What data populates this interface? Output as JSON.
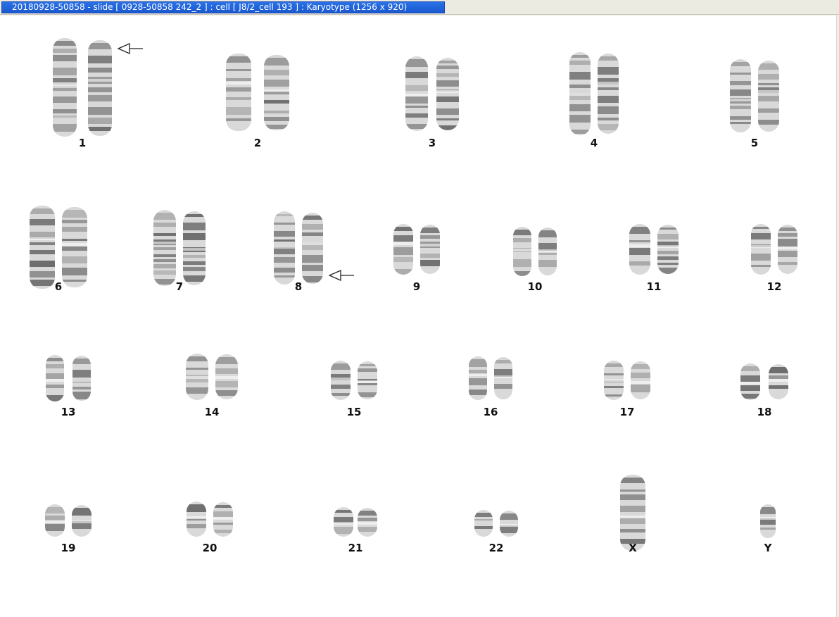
{
  "window": {
    "title": "20180928-50858 - slide [ 0928-50858 242_2 ] : cell [ J8/2_cell 193 ] : Karyotype  (1256 x 920)"
  },
  "colors": {
    "chromosome_light": "#d9d9d9",
    "chromosome_band": "#5a5a5a",
    "title_active": "#2a71e6",
    "title_text": "#ffffff"
  },
  "karyotype": {
    "chromosomes": [
      {
        "label": "1",
        "count": 2,
        "flagged": true
      },
      {
        "label": "2",
        "count": 2,
        "flagged": false
      },
      {
        "label": "3",
        "count": 2,
        "flagged": false
      },
      {
        "label": "4",
        "count": 2,
        "flagged": false
      },
      {
        "label": "5",
        "count": 2,
        "flagged": false
      },
      {
        "label": "6",
        "count": 2,
        "flagged": false
      },
      {
        "label": "7",
        "count": 2,
        "flagged": false
      },
      {
        "label": "8",
        "count": 2,
        "flagged": true
      },
      {
        "label": "9",
        "count": 2,
        "flagged": false
      },
      {
        "label": "10",
        "count": 2,
        "flagged": false
      },
      {
        "label": "11",
        "count": 2,
        "flagged": false
      },
      {
        "label": "12",
        "count": 2,
        "flagged": false
      },
      {
        "label": "13",
        "count": 2,
        "flagged": false
      },
      {
        "label": "14",
        "count": 2,
        "flagged": false
      },
      {
        "label": "15",
        "count": 2,
        "flagged": false
      },
      {
        "label": "16",
        "count": 2,
        "flagged": false
      },
      {
        "label": "17",
        "count": 2,
        "flagged": false
      },
      {
        "label": "18",
        "count": 2,
        "flagged": false
      },
      {
        "label": "19",
        "count": 2,
        "flagged": false
      },
      {
        "label": "20",
        "count": 2,
        "flagged": false
      },
      {
        "label": "21",
        "count": 2,
        "flagged": false
      },
      {
        "label": "22",
        "count": 2,
        "flagged": false
      },
      {
        "label": "X",
        "count": 1,
        "flagged": false
      },
      {
        "label": "Y",
        "count": 1,
        "flagged": false
      }
    ],
    "icons": {
      "flag": "arrow-left-icon"
    }
  }
}
